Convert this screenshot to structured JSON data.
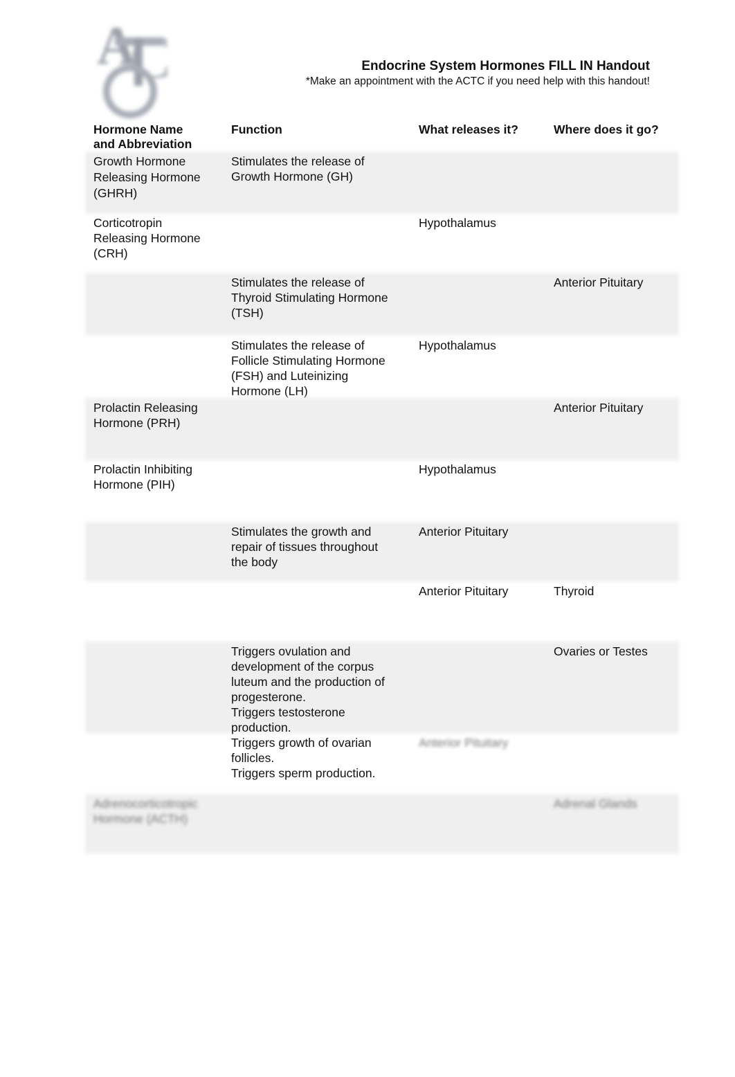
{
  "header": {
    "logo_text": "ATC",
    "title": "Endocrine System Hormones FILL IN Handout",
    "subtitle": "*Make an appointment with the ACTC if you need help with this handout!"
  },
  "table": {
    "columns": [
      "Hormone Name\nand Abbreviation",
      "Function",
      "What releases it?",
      "Where does it go?"
    ],
    "rows": [
      {
        "name": "Growth Hormone\nReleasing Hormone\n(GHRH)",
        "function": "Stimulates the release of\nGrowth Hormone (GH)",
        "released_by": "",
        "target": ""
      },
      {
        "name": "Corticotropin\nReleasing Hormone\n(CRH)",
        "function": "",
        "released_by": "Hypothalamus",
        "target": ""
      },
      {
        "name": "",
        "function": "Stimulates the release of\nThyroid Stimulating Hormone\n(TSH)",
        "released_by": "",
        "target": "Anterior Pituitary"
      },
      {
        "name": "",
        "function": "Stimulates the release of\nFollicle Stimulating Hormone\n(FSH) and Luteinizing\nHormone (LH)",
        "released_by": "Hypothalamus",
        "target": ""
      },
      {
        "name": "Prolactin Releasing\nHormone (PRH)",
        "function": "",
        "released_by": "",
        "target": "Anterior Pituitary"
      },
      {
        "name": "Prolactin Inhibiting\nHormone (PIH)",
        "function": "",
        "released_by": "Hypothalamus",
        "target": ""
      },
      {
        "name": "",
        "function": "Stimulates the growth and\nrepair of tissues throughout\nthe body",
        "released_by": "Anterior Pituitary",
        "target": ""
      },
      {
        "name": "",
        "function": "",
        "released_by": "Anterior Pituitary",
        "target": "Thyroid"
      },
      {
        "name": "",
        "function": "Triggers ovulation and\ndevelopment of the corpus\nluteum and the production of\nprogesterone.\nTriggers testosterone\nproduction.\nTriggers growth of ovarian\nfollicles.\nTriggers sperm production.",
        "released_by": "",
        "target": "Ovaries or Testes"
      },
      {
        "name": "",
        "function": "",
        "released_by": "Anterior Pituitary",
        "target": ""
      },
      {
        "name": "Adrenocorticotropic\nHormone (ACTH)",
        "function": "",
        "released_by": "",
        "target": "Adrenal Glands"
      }
    ]
  }
}
